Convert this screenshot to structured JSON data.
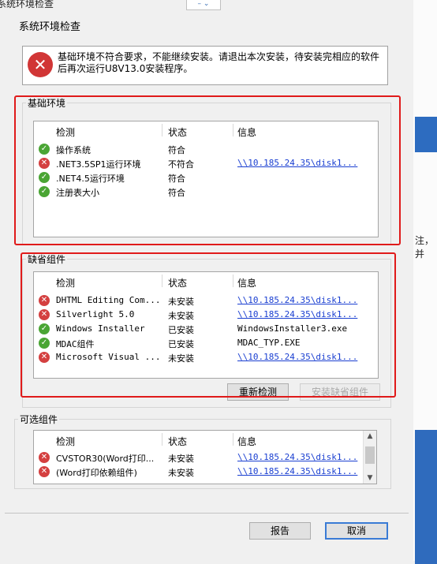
{
  "window": {
    "title": "系统环境检查",
    "combo_label": "– ⌄"
  },
  "page": {
    "header": "系统环境检查"
  },
  "message": {
    "icon": "error-icon",
    "text": "基础环境不符合要求，不能继续安装。请退出本次安装，待安装完相应的软件后再次运行U8V13.0安装程序。"
  },
  "columns": {
    "check": "检测",
    "status": "状态",
    "info": "信息"
  },
  "basic": {
    "title": "基础环境",
    "rows": [
      {
        "icon": "check-icon",
        "name": "操作系统",
        "status": "符合",
        "info": ""
      },
      {
        "icon": "error-icon",
        "name": ".NET3.5SP1运行环境",
        "status": "不符合",
        "info": "\\\\10.185.24.35\\disk1..."
      },
      {
        "icon": "check-icon",
        "name": ".NET4.5运行环境",
        "status": "符合",
        "info": ""
      },
      {
        "icon": "check-icon",
        "name": "注册表大小",
        "status": "符合",
        "info": ""
      }
    ]
  },
  "default_components": {
    "title": "缺省组件",
    "rows": [
      {
        "icon": "error-icon",
        "name": "DHTML Editing Com...",
        "status": "未安装",
        "info": "\\\\10.185.24.35\\disk1...",
        "link": true
      },
      {
        "icon": "error-icon",
        "name": "Silverlight 5.0",
        "status": "未安装",
        "info": "\\\\10.185.24.35\\disk1...",
        "link": true
      },
      {
        "icon": "check-icon",
        "name": "Windows Installer",
        "status": "已安装",
        "info": "WindowsInstaller3.exe",
        "link": false
      },
      {
        "icon": "check-icon",
        "name": "MDAC组件",
        "status": "已安装",
        "info": "MDAC_TYP.EXE",
        "link": false
      },
      {
        "icon": "error-icon",
        "name": "Microsoft Visual ...",
        "status": "未安装",
        "info": "\\\\10.185.24.35\\disk1...",
        "link": true
      }
    ],
    "recheck_button": "重新检测",
    "install_button": "安装缺省组件"
  },
  "optional_components": {
    "title": "可选组件",
    "rows": [
      {
        "icon": "error-icon",
        "name": "CVSTOR30(Word打印...",
        "status": "未安装",
        "info": "\\\\10.185.24.35\\disk1..."
      },
      {
        "icon": "error-icon",
        "name": "(Word打印依赖组件)",
        "status": "未安装",
        "info": "\\\\10.185.24.35\\disk1..."
      }
    ]
  },
  "footer": {
    "report_button": "报告",
    "cancel_button": "取消"
  },
  "background_text": "注，并",
  "accent_color": "#e01a1a"
}
